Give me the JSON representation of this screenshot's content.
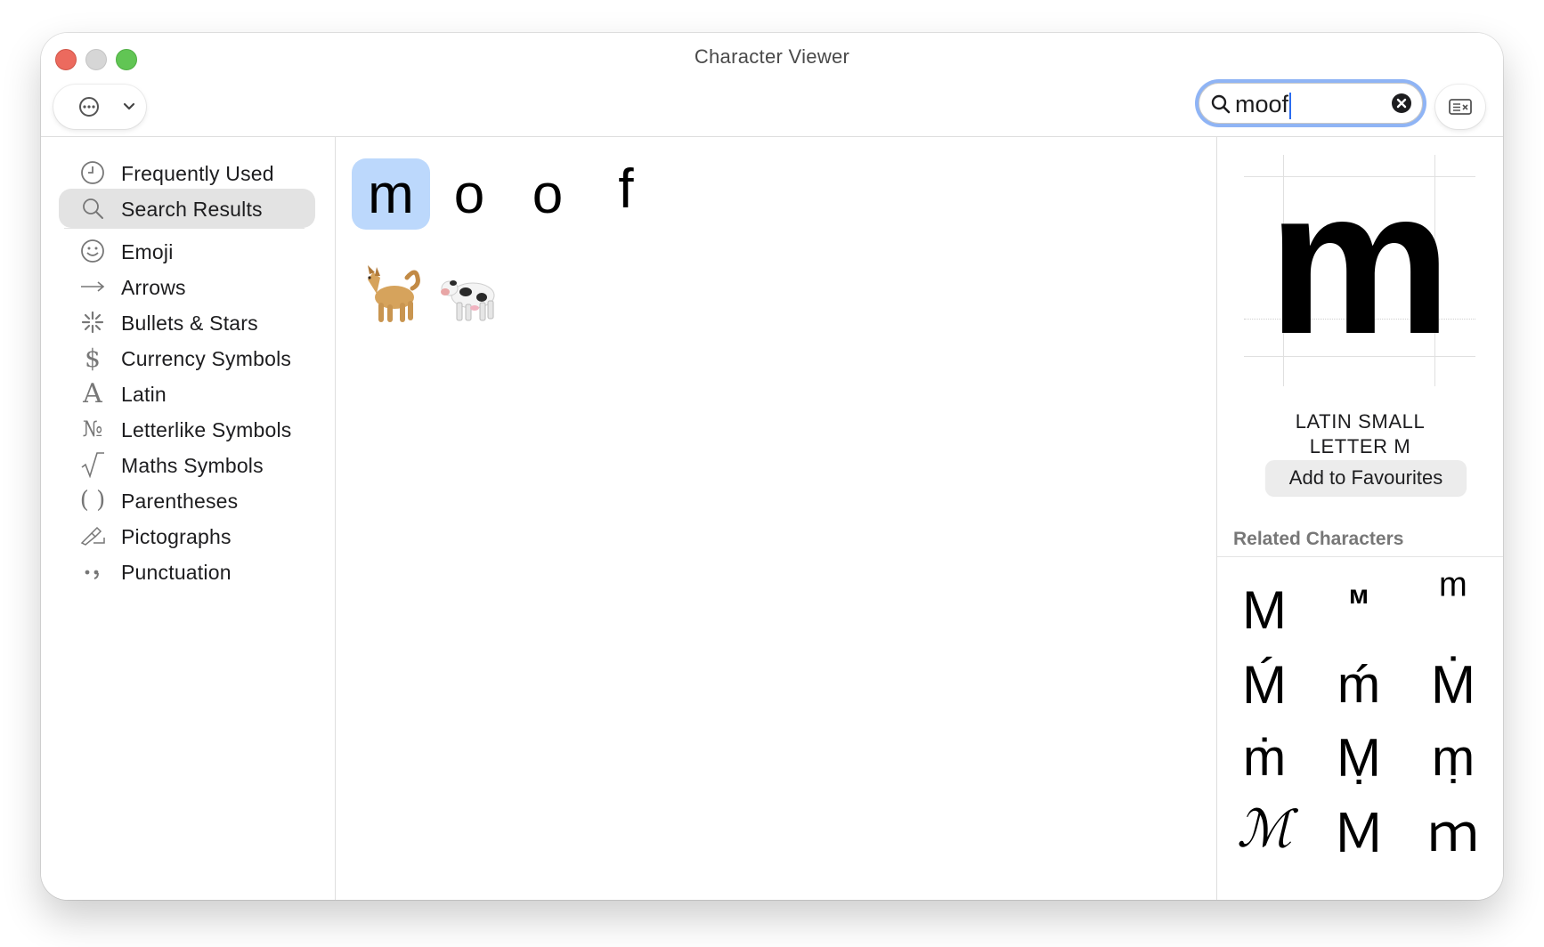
{
  "window": {
    "title": "Character Viewer"
  },
  "toolbar": {
    "search": {
      "value": "moof"
    }
  },
  "sidebar": {
    "items": [
      {
        "label": "Frequently Used",
        "icon": "clock-icon",
        "selected": false
      },
      {
        "label": "Search Results",
        "icon": "magnifier-icon",
        "selected": true
      },
      {
        "label": "Emoji",
        "icon": "smiley-icon",
        "selected": false
      },
      {
        "label": "Arrows",
        "icon": "arrow-icon",
        "selected": false
      },
      {
        "label": "Bullets & Stars",
        "icon": "asterisk-icon",
        "selected": false
      },
      {
        "label": "Currency Symbols",
        "icon": "dollar-icon",
        "selected": false
      },
      {
        "label": "Latin",
        "icon": "latin-a-icon",
        "selected": false
      },
      {
        "label": "Letterlike Symbols",
        "icon": "numero-icon",
        "selected": false
      },
      {
        "label": "Maths Symbols",
        "icon": "square-root-icon",
        "selected": false
      },
      {
        "label": "Parentheses",
        "icon": "parentheses-icon",
        "selected": false
      },
      {
        "label": "Pictographs",
        "icon": "pictograph-icon",
        "selected": false
      },
      {
        "label": "Punctuation",
        "icon": "punctuation-icon",
        "selected": false
      }
    ]
  },
  "results": {
    "characters": [
      "m",
      "o",
      "o",
      "f"
    ],
    "selected_index": 0,
    "emoji": [
      {
        "name": "dog",
        "icon": "dog-emoji-icon"
      },
      {
        "name": "cow",
        "icon": "cow-emoji-icon"
      }
    ]
  },
  "detail": {
    "glyph": "m",
    "name_line1": "LATIN SMALL",
    "name_line2": "LETTER M",
    "favourite_label": "Add to Favourites",
    "related_title": "Related Characters",
    "related": [
      "M",
      "ᴍ",
      "ᵐ",
      "Ḿ",
      "ḿ",
      "Ṁ",
      "ṁ",
      "Ṃ",
      "ṃ",
      "ℳ",
      "Ｍ",
      "ｍ"
    ]
  },
  "colors": {
    "selection_blue": "#bcd8fc",
    "search_focus_ring": "#8fb4f5",
    "sidebar_selected": "#e3e3e3",
    "close": "#ec6a5e",
    "zoom": "#61c554"
  }
}
